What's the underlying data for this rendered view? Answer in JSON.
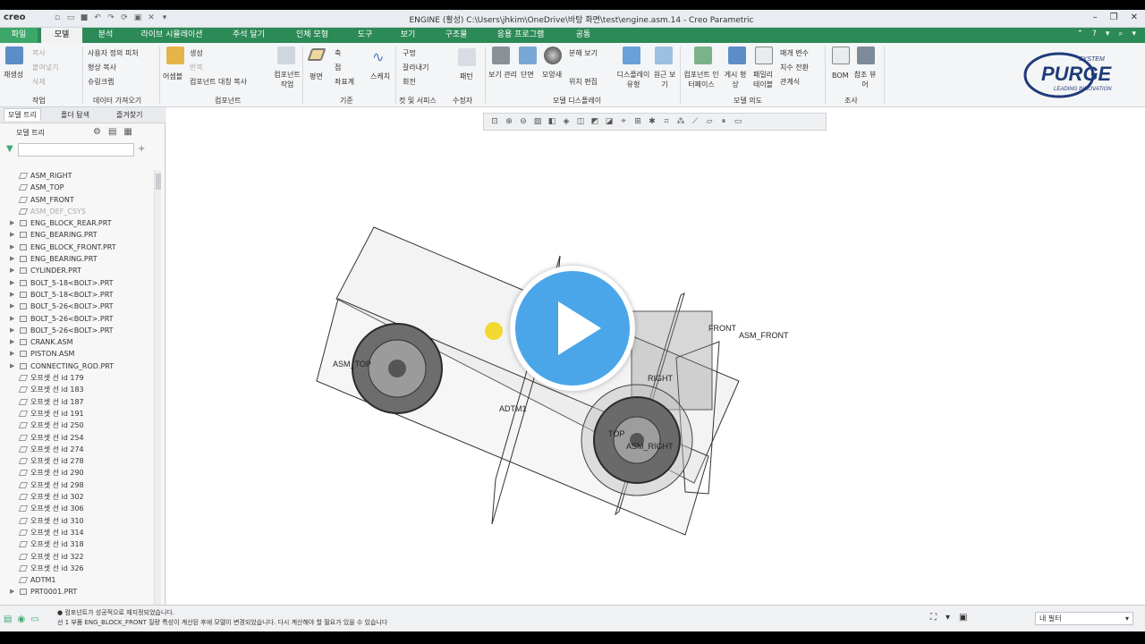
{
  "window": {
    "logo": "creo",
    "title": "ENGINE (활성) C:\\Users\\jhkim\\OneDrive\\바탕 화면\\test\\engine.asm.14 - Creo Parametric"
  },
  "tabs": [
    {
      "label": "파일"
    },
    {
      "label": "모델"
    },
    {
      "label": "분석"
    },
    {
      "label": "라이브 시뮬레이션"
    },
    {
      "label": "주석 달기"
    },
    {
      "label": "인체 모형"
    },
    {
      "label": "도구"
    },
    {
      "label": "보기"
    },
    {
      "label": "구조물"
    },
    {
      "label": "응용 프로그램"
    },
    {
      "label": "공통"
    }
  ],
  "ribbon": {
    "regen": "재생성",
    "copy": "복사",
    "paste": "붙여넣기",
    "delete": "삭제",
    "user_feature": "사용자 정의 피처",
    "shrinkwrap": "형상 복사",
    "shrink": "슈링크랩",
    "assemble": "어셈블",
    "create": "생성",
    "repeat": "반복",
    "component_mirror": "컴포넌트 대칭 복사",
    "component_ops": "컴포넌트 작업",
    "plane": "평면",
    "axis": "축",
    "point": "점",
    "csys": "좌표계",
    "sketch": "스케치",
    "hole": "구멍",
    "cut": "잘라내기",
    "round": "회전",
    "pattern": "패턴",
    "manage_views": "보기 관리",
    "section": "단면",
    "appearance": "모양새",
    "exploded": "분해 보기",
    "edit_position": "위치 편집",
    "display_style": "디스플레이 유형",
    "perspective": "원근 보기",
    "component_interface": "컴포넌트 인터페이스",
    "publish_geom": "게시 형상",
    "family_table": "패밀리 테이블",
    "param": "매개 변수",
    "switch_dim": "치수 전환",
    "relations": "관계식",
    "bom": "BOM",
    "ref_viewer": "참조 뷰어",
    "groups": {
      "operations": "작업",
      "get_data": "데이터 가져오기",
      "component": "컴포넌트",
      "datum": "기준",
      "cut_surface": "컷 및 서피스",
      "modifiers": "수정자",
      "model_display": "모델 디스플레이",
      "model_intent": "모델 의도",
      "investigate": "조사"
    },
    "brand": "PURGE",
    "brand_top": "SYSTEM",
    "brand_sub": "LEADING INNOVATION"
  },
  "panel": {
    "tabs": [
      "모델 트리",
      "폴더 탐색",
      "즐겨찾기"
    ],
    "tree_header": "모델 트리",
    "search_placeholder": "",
    "items": [
      {
        "label": "ASM_RIGHT",
        "exp": "",
        "dim": false
      },
      {
        "label": "ASM_TOP",
        "exp": "",
        "dim": false
      },
      {
        "label": "ASM_FRONT",
        "exp": "",
        "dim": false
      },
      {
        "label": "ASM_DEF_CSYS",
        "exp": "",
        "dim": true
      },
      {
        "label": "ENG_BLOCK_REAR.PRT",
        "exp": "▶",
        "dim": false
      },
      {
        "label": "ENG_BEARING.PRT",
        "exp": "▶",
        "dim": false
      },
      {
        "label": "ENG_BLOCK_FRONT.PRT",
        "exp": "▶",
        "dim": false
      },
      {
        "label": "ENG_BEARING.PRT",
        "exp": "▶",
        "dim": false
      },
      {
        "label": "CYLINDER.PRT",
        "exp": "▶",
        "dim": false
      },
      {
        "label": "BOLT_5-18<BOLT>.PRT",
        "exp": "▶",
        "dim": false
      },
      {
        "label": "BOLT_5-18<BOLT>.PRT",
        "exp": "▶",
        "dim": false
      },
      {
        "label": "BOLT_5-26<BOLT>.PRT",
        "exp": "▶",
        "dim": false
      },
      {
        "label": "BOLT_5-26<BOLT>.PRT",
        "exp": "▶",
        "dim": false
      },
      {
        "label": "BOLT_5-26<BOLT>.PRT",
        "exp": "▶",
        "dim": false
      },
      {
        "label": "CRANK.ASM",
        "exp": "▶",
        "dim": false
      },
      {
        "label": "PISTON.ASM",
        "exp": "▶",
        "dim": false
      },
      {
        "label": "CONNECTING_ROD.PRT",
        "exp": "▶",
        "dim": false
      },
      {
        "label": "오프셋 선 id 179",
        "exp": "",
        "dim": false
      },
      {
        "label": "오프셋 선 id 183",
        "exp": "",
        "dim": false
      },
      {
        "label": "오프셋 선 id 187",
        "exp": "",
        "dim": false
      },
      {
        "label": "오프셋 선 id 191",
        "exp": "",
        "dim": false
      },
      {
        "label": "오프셋 선 id 250",
        "exp": "",
        "dim": false
      },
      {
        "label": "오프셋 선 id 254",
        "exp": "",
        "dim": false
      },
      {
        "label": "오프셋 선 id 274",
        "exp": "",
        "dim": false
      },
      {
        "label": "오프셋 선 id 278",
        "exp": "",
        "dim": false
      },
      {
        "label": "오프셋 선 id 290",
        "exp": "",
        "dim": false
      },
      {
        "label": "오프셋 선 id 298",
        "exp": "",
        "dim": false
      },
      {
        "label": "오프셋 선 id 302",
        "exp": "",
        "dim": false
      },
      {
        "label": "오프셋 선 id 306",
        "exp": "",
        "dim": false
      },
      {
        "label": "오프셋 선 id 310",
        "exp": "",
        "dim": false
      },
      {
        "label": "오프셋 선 id 314",
        "exp": "",
        "dim": false
      },
      {
        "label": "오프셋 선 id 318",
        "exp": "",
        "dim": false
      },
      {
        "label": "오프셋 선 id 322",
        "exp": "",
        "dim": false
      },
      {
        "label": "오프셋 선 id 326",
        "exp": "",
        "dim": false
      },
      {
        "label": "ADTM1",
        "exp": "",
        "dim": false
      },
      {
        "label": "PRT0001.PRT",
        "exp": "▶",
        "dim": false
      }
    ]
  },
  "canvas": {
    "labels": {
      "asm_top": "ASM_TOP",
      "adtm1": "ADTM1",
      "front": "FRONT",
      "asm_front": "ASM_FRONT",
      "right": "RIGHT",
      "top": "TOP",
      "asm_right": "ASM_RIGHT"
    }
  },
  "status": {
    "line1": "● 컴포넌트가 성공적으로 재지정되었습니다.",
    "line2": "선 1 부품 ENG_BLOCK_FRONT 질량 특성이 계산된 후에 모델이 변경되었습니다. 다시 계산해야 할 필요가 있을 수 있습니다",
    "filter": "내 필터"
  },
  "colors": {
    "tab_bar": "#2c8a57",
    "play": "#4aa6e8",
    "brand": "#1f3b7a"
  }
}
